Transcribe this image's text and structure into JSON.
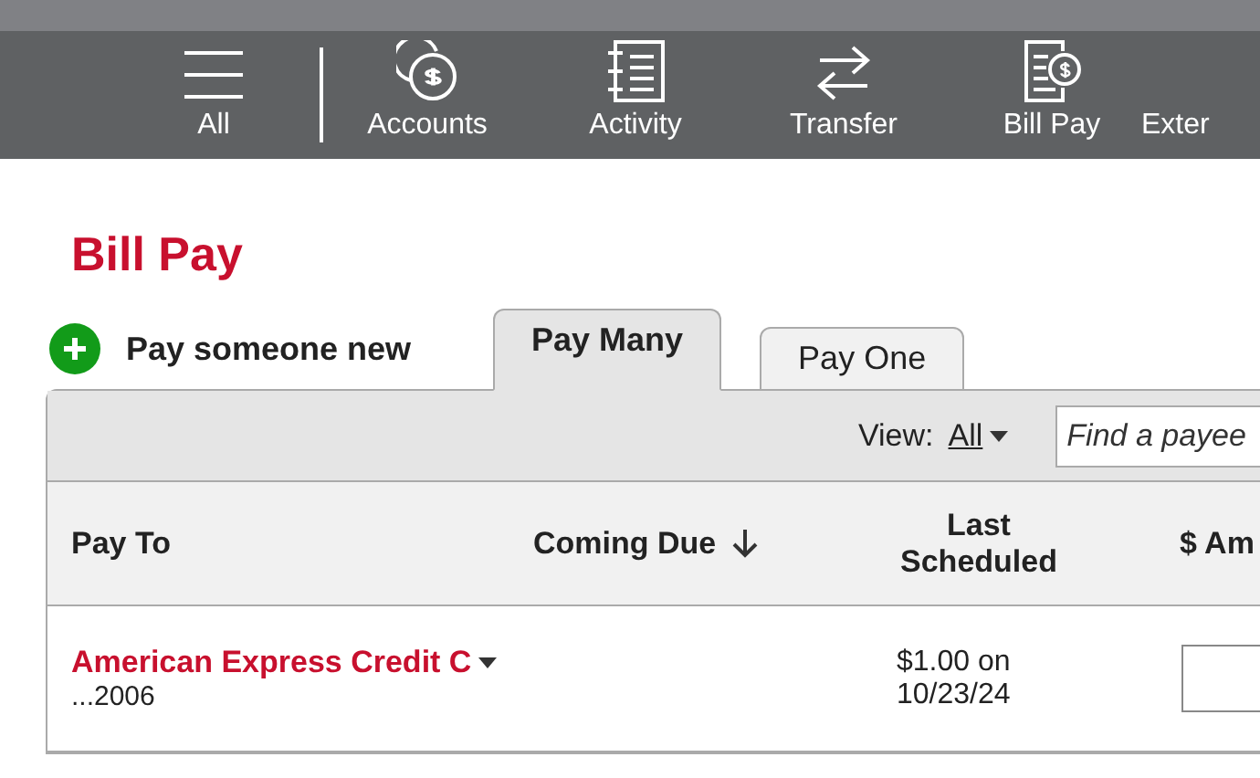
{
  "nav": [
    {
      "label": "All"
    },
    {
      "label": "Accounts"
    },
    {
      "label": "Activity"
    },
    {
      "label": "Transfer"
    },
    {
      "label": "Bill Pay"
    },
    {
      "label": "Exter"
    }
  ],
  "title": "Bill Pay",
  "add_payee": "Pay someone new",
  "tabs": [
    {
      "label": "Pay Many",
      "selected": true
    },
    {
      "label": "Pay One",
      "selected": false
    }
  ],
  "toolbar": {
    "view_label": "View:",
    "view_value": "All",
    "search": {
      "placeholder": "Find a payee"
    }
  },
  "table": {
    "columns": [
      {
        "label": "Pay To",
        "sort": false
      },
      {
        "label": "Coming Due",
        "sort": true
      },
      {
        "label": "Last Scheduled",
        "sort": false
      },
      {
        "label": "$ Am",
        "sort": false
      }
    ],
    "rows": [
      {
        "payee": "American Express Credit C",
        "account": "...2006",
        "last_scheduled": "$1.00 on 10/23/24"
      }
    ]
  }
}
